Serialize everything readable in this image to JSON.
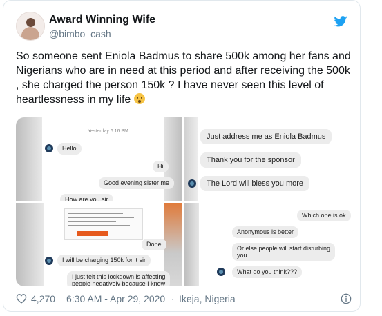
{
  "tweet": {
    "display_name": "Award Winning Wife",
    "handle": "@bimbo_cash",
    "text": "So someone sent Eniola Badmus to share 500k among her fans and Nigerians who are in need at this period and after receiving the 500k , she charged the person 150k ? I have never seen this level of heartlessness in my life",
    "emoji": "hushed-face-emoji",
    "likes": "4,270",
    "timestamp": "6:30 AM - Apr 29, 2020",
    "location": "Ikeja, Nigeria",
    "brand_color": "#1da1f2",
    "heart_color": "#657786"
  },
  "media": {
    "panel1": {
      "timestamp": "Yesterday 6:16 PM",
      "msg_hello": "Hello",
      "msg_hi": "Hi",
      "msg_good_evening": "Good evening sister me",
      "msg_how_are_you": "How are you sir"
    },
    "panel2": {
      "msg_address": "Just address me as Eniola Badmus",
      "msg_thanks": "Thank you for the sponsor",
      "msg_bless": "The Lord will bless you more"
    },
    "panel3": {
      "msg_done": "Done",
      "msg_charging": "I will be charging 150k for it sir",
      "msg_lockdown_1": "I just felt this lockdown is affecting",
      "msg_lockdown_2": "people negatively because I know"
    },
    "panel4": {
      "msg_which": "Which one is ok",
      "msg_anonymous": "Anonymous is better",
      "msg_else_1": "Or else people will start disturbing",
      "msg_else_2": "you",
      "msg_think": "What do you think???"
    }
  }
}
